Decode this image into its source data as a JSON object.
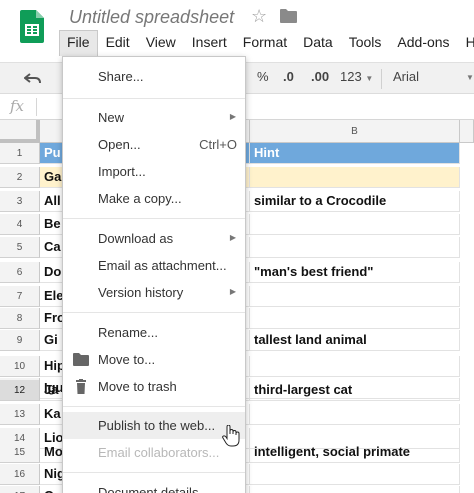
{
  "app": {
    "title": "Untitled spreadsheet",
    "menus": [
      "File",
      "Edit",
      "View",
      "Insert",
      "Format",
      "Data",
      "Tools",
      "Add-ons",
      "H"
    ],
    "active_menu": "File"
  },
  "toolbar": {
    "percent": "%",
    "dec_decrease": ".0",
    "dec_increase": ".00",
    "more_formats": "123",
    "font": "Arial"
  },
  "formula_bar": {
    "fx": "fx"
  },
  "grid": {
    "col_b_header": "B",
    "rows": [
      {
        "num": "1",
        "a": "Pu",
        "b": "Hint"
      },
      {
        "num": "2",
        "a": "Ga",
        "b": ""
      },
      {
        "num": "3",
        "a": "All",
        "b": "similar to a Crocodile"
      },
      {
        "num": "4",
        "a": "Be",
        "b": ""
      },
      {
        "num": "5",
        "a": "Ca",
        "b": ""
      },
      {
        "num": "6",
        "a": "Do",
        "b": "\"man's best friend\""
      },
      {
        "num": "7",
        "a": "Ele",
        "b": ""
      },
      {
        "num": "8",
        "a": "Fro",
        "b": ""
      },
      {
        "num": "9",
        "a": "Gi",
        "b": "tallest land animal"
      },
      {
        "num": "10",
        "a": "Hip",
        "b": ""
      },
      {
        "num": "11",
        "a": "Igu",
        "b": ""
      },
      {
        "num": "12",
        "a": "Ja",
        "b": "third-largest cat"
      },
      {
        "num": "13",
        "a": "Ka",
        "b": ""
      },
      {
        "num": "14",
        "a": "Lio",
        "b": ""
      },
      {
        "num": "15",
        "a": "Mo",
        "b": "intelligent, social primate"
      },
      {
        "num": "16",
        "a": "Nig",
        "b": ""
      },
      {
        "num": "17",
        "a": "O",
        "b": ""
      }
    ]
  },
  "file_menu": {
    "share": "Share...",
    "new": "New",
    "open": "Open...",
    "open_shortcut": "Ctrl+O",
    "import": "Import...",
    "make_copy": "Make a copy...",
    "download_as": "Download as",
    "email_attachment": "Email as attachment...",
    "version_history": "Version history",
    "rename": "Rename...",
    "move_to": "Move to...",
    "move_to_trash": "Move to trash",
    "publish": "Publish to the web...",
    "email_collaborators": "Email collaborators...",
    "document_details": "Document details..."
  },
  "colors": {
    "header_fill": "#6fa8dc",
    "highlight_fill": "#fff2cc",
    "sheets_green": "#0f9d58"
  }
}
